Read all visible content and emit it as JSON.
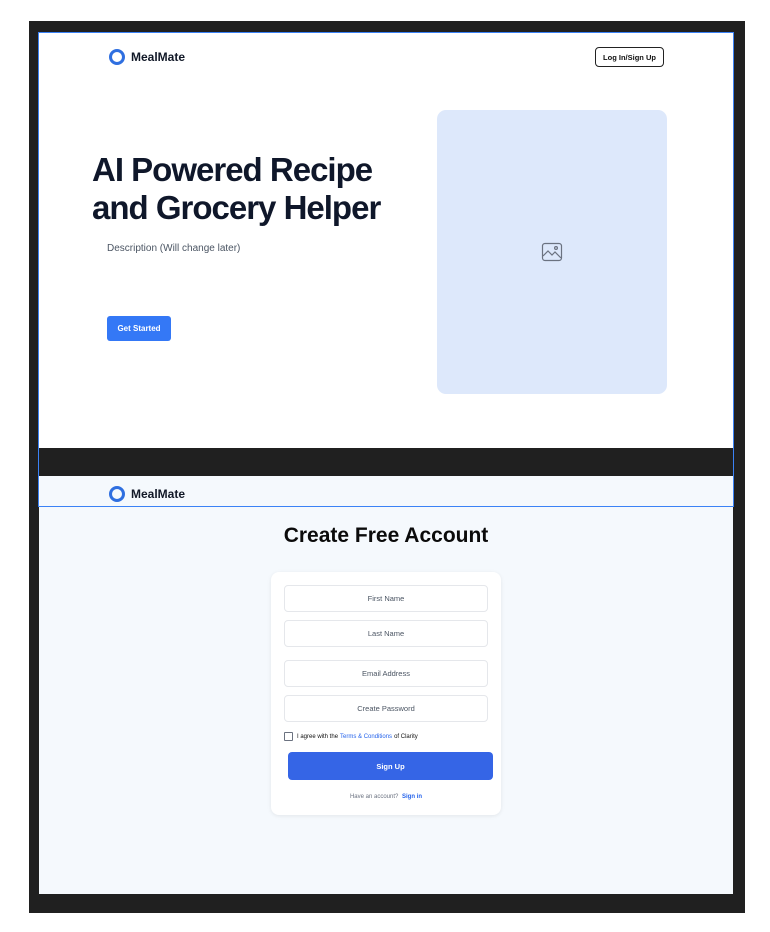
{
  "landing": {
    "brand": "MealMate",
    "login_label": "Log In/Sign Up",
    "hero_title": "AI Powered Recipe\nand Grocery Helper",
    "description": "Description (Will change later)",
    "cta_label": "Get Started",
    "image_icon": "image-icon"
  },
  "signup": {
    "brand": "MealMate",
    "title": "Create Free Account",
    "fields": {
      "first_name": "First Name",
      "last_name": "Last Name",
      "email": "Email Address",
      "password": "Create Password"
    },
    "agree_prefix": "I agree with the",
    "agree_link": "Terms & Conditions",
    "agree_suffix": "of Clarity",
    "signup_label": "Sign Up",
    "have_account": "Have an account?",
    "signin_label": "Sign in"
  },
  "colors": {
    "accent": "#3478f6",
    "signup_button": "#3565e6",
    "placeholder_bg": "#dde8fb",
    "frame_bg": "#202020"
  }
}
